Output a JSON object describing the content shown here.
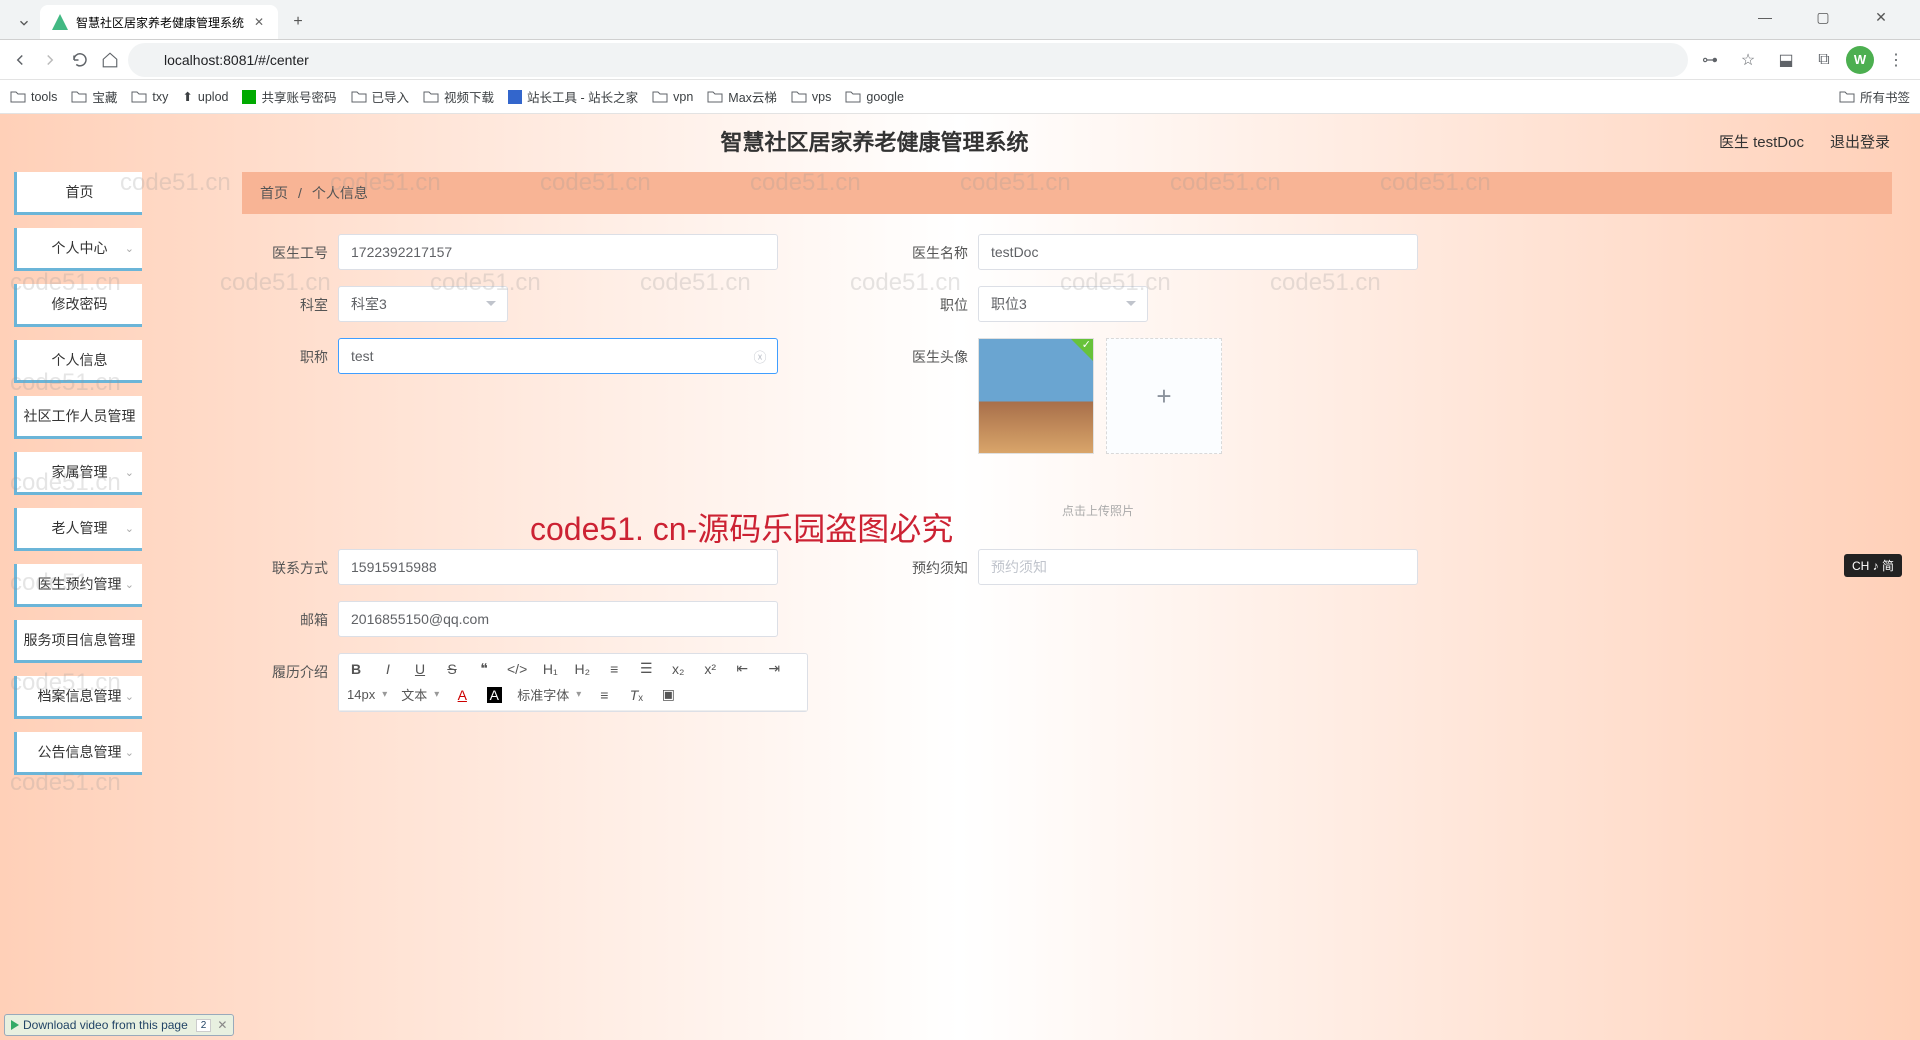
{
  "browser": {
    "tab_title": "智慧社区居家养老健康管理系统",
    "url": "localhost:8081/#/center",
    "profile_letter": "W"
  },
  "bookmarks": {
    "items": [
      "tools",
      "宝藏",
      "txy",
      "uplod",
      "共享账号密码",
      "已导入",
      "视频下载",
      "站长工具 - 站长之家",
      "vpn",
      "Max云梯",
      "vps",
      "google"
    ],
    "right": "所有书签"
  },
  "header": {
    "title": "智慧社区居家养老健康管理系统",
    "user": "医生 testDoc",
    "logout": "退出登录"
  },
  "sidebar": {
    "items": [
      {
        "label": "首页",
        "expandable": false
      },
      {
        "label": "个人中心",
        "expandable": true
      },
      {
        "label": "修改密码",
        "expandable": false,
        "sub": true
      },
      {
        "label": "个人信息",
        "expandable": false,
        "sub": true
      },
      {
        "label": "社区工作人员管理",
        "expandable": false
      },
      {
        "label": "家属管理",
        "expandable": true
      },
      {
        "label": "老人管理",
        "expandable": true
      },
      {
        "label": "医生预约管理",
        "expandable": true
      },
      {
        "label": "服务项目信息管理",
        "expandable": false
      },
      {
        "label": "档案信息管理",
        "expandable": true
      },
      {
        "label": "公告信息管理",
        "expandable": true
      }
    ]
  },
  "breadcrumb": {
    "home": "首页",
    "sep": "/",
    "current": "个人信息"
  },
  "form": {
    "doctor_id_label": "医生工号",
    "doctor_id_value": "1722392217157",
    "doctor_name_label": "医生名称",
    "doctor_name_value": "testDoc",
    "dept_label": "科室",
    "dept_value": "科室3",
    "position_label": "职位",
    "position_value": "职位3",
    "title_label": "职称",
    "title_value": "test",
    "avatar_label": "医生头像",
    "upload_hint": "点击上传照片",
    "contact_label": "联系方式",
    "contact_value": "15915915988",
    "notice_label": "预约须知",
    "notice_placeholder": "预约须知",
    "email_label": "邮箱",
    "email_value": "2016855150@qq.com",
    "resume_label": "履历介绍"
  },
  "editor": {
    "font_size": "14px",
    "font_style": "文本",
    "font_family": "标准字体"
  },
  "watermark_text": "code51.cn",
  "big_watermark": "code51. cn-源码乐园盗图必究",
  "download_bar": "Download video from this page",
  "download_count": "2",
  "ime": "CH ♪ 简"
}
